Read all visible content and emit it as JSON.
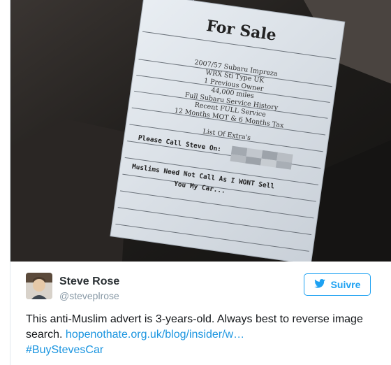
{
  "photo": {
    "sign_title": "For Sale",
    "sign_lines": [
      "2007/57 Subaru Impreza",
      "WRX Sti Type UK",
      "1 Previous Owner",
      "44,000 miles",
      "Full Subaru Service History",
      "Recent FULL Service",
      "12 Months MOT & 6 Months Tax",
      "List Of Extra's"
    ],
    "call_line": "Please Call Steve On:",
    "statement_line1": "Muslims Need Not Call As I WONT Sell",
    "statement_line2": "You My Car..."
  },
  "tweet": {
    "author_name": "Steve Rose",
    "author_handle": "@steveplrose",
    "follow_label": "Suivre",
    "text_before_link": "This anti-Muslim advert is 3-years-old. Always best to reverse image search. ",
    "link_text": "hopenothate.org.uk/blog/insider/w…",
    "hashtag": "#BuyStevesCar"
  },
  "colors": {
    "accent": "#1da1f2",
    "link": "#1b95e0",
    "text": "#14171a",
    "muted": "#8899a6"
  },
  "icons": {
    "follow": "twitter-bird-icon"
  }
}
